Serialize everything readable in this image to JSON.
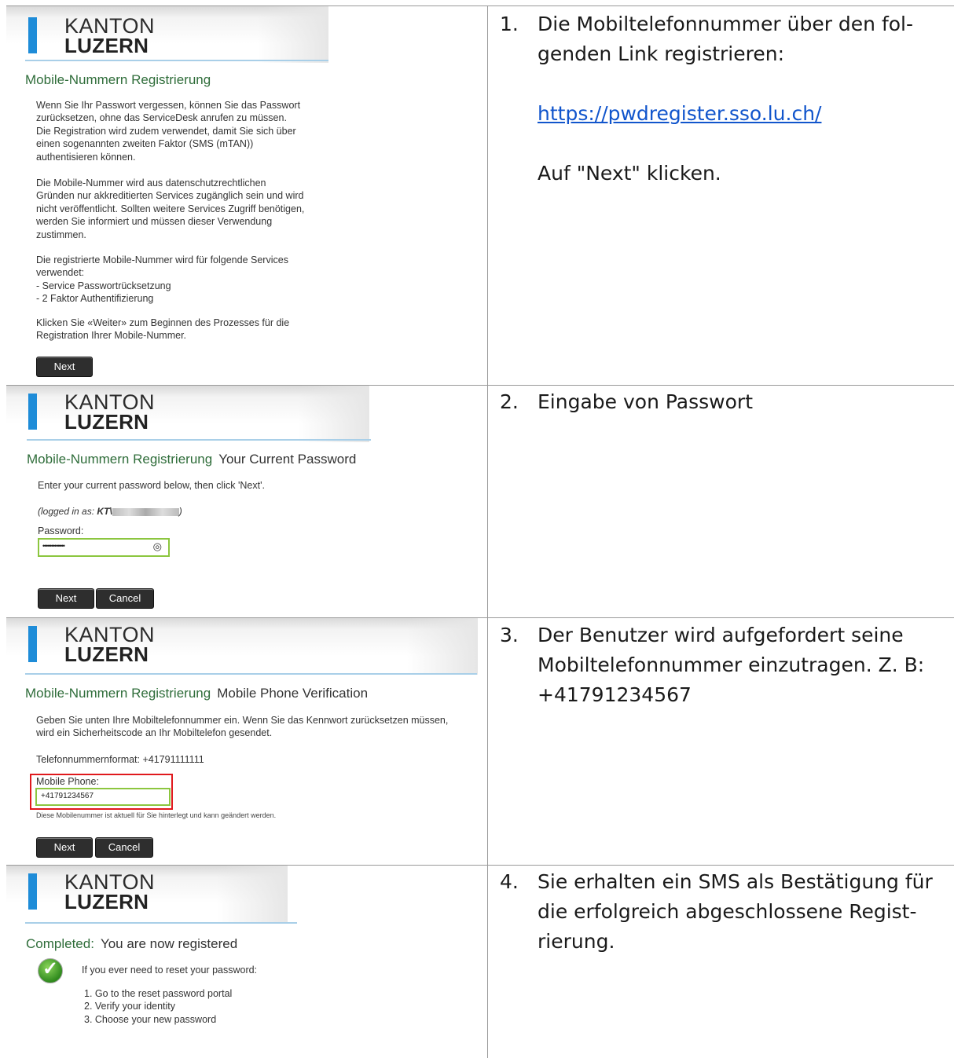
{
  "logo": {
    "line1": "KANTON",
    "line2": "LUZERN"
  },
  "colors": {
    "brand_blue": "#1e8cd8",
    "title_green": "#2f6d3a",
    "field_green": "#8cc63f",
    "highlight_red": "#e0191d",
    "link_blue": "#1155cc"
  },
  "step1": {
    "title": "Mobile-Nummern Registrierung",
    "paragraphs": [
      "Wenn Sie Ihr Passwort vergessen, können Sie das Passwort\nzurücksetzen, ohne das ServiceDesk anrufen zu müssen.\nDie Registration wird zudem verwendet, damit Sie sich über\neinen sogenannten zweiten Faktor (SMS (mTAN))\nauthentisieren können.",
      "Die Mobile-Nummer wird aus datenschutzrechtlichen\nGründen nur akkreditierten Services zugänglich sein und wird\nnicht veröffentlicht. Sollten weitere Services Zugriff benötigen,\nwerden Sie informiert und müssen dieser Verwendung\nzustimmen.",
      "Die registrierte Mobile-Nummer wird für folgende Services\nverwendet:\n- Service Passwortrücksetzung\n- 2 Faktor Authentifizierung",
      "Klicken Sie «Weiter» zum Beginnen des Prozesses für die\nRegistration Ihrer Mobile-Nummer."
    ],
    "next_label": "Next",
    "num": "1.",
    "desc_line1": "Die Mobiltelefonnummer über den fol-\ngenden Link registrieren:",
    "link": "https://pwdregister.sso.lu.ch/",
    "desc_line2": "Auf \"Next\" klicken."
  },
  "step2": {
    "title": "Mobile-Nummern Registrierung",
    "subtitle": "Your Current Password",
    "instruction": "Enter your current password below, then click 'Next'.",
    "logged_prefix": "(logged in as: ",
    "logged_user": "KT\\",
    "logged_suffix": ")",
    "password_label": "Password:",
    "password_value": "•••••••••••••",
    "next_label": "Next",
    "cancel_label": "Cancel",
    "num": "2.",
    "desc": "Eingabe von Passwort"
  },
  "step3": {
    "title": "Mobile-Nummern Registrierung",
    "subtitle": "Mobile Phone Verification",
    "instruction": "Geben Sie unten Ihre Mobiltelefonnummer ein. Wenn Sie das Kennwort zurücksetzen müssen,\nwird ein Sicherheitscode an Ihr Mobiltelefon gesendet.",
    "format": "Telefonnummernformat: +41791111111",
    "phone_label": "Mobile Phone:",
    "phone_value": "+41791234567",
    "note": "Diese Mobilenummer ist aktuell für Sie hinterlegt und kann geändert werden.",
    "next_label": "Next",
    "cancel_label": "Cancel",
    "num": "3.",
    "desc": "Der Benutzer wird aufgefordert seine\nMobiltelefonnummer einzutragen. Z. B:\n+41791234567"
  },
  "step4": {
    "title": "Completed:",
    "subtitle": "You are now registered",
    "lead": "If you ever need to reset your password:",
    "steps": "1. Go to the reset password portal\n2. Verify your identity\n3. Choose your new password",
    "num": "4.",
    "desc": "Sie erhalten ein SMS als Bestätigung für\ndie erfolgreich abgeschlossene Regist-\nrierung."
  }
}
